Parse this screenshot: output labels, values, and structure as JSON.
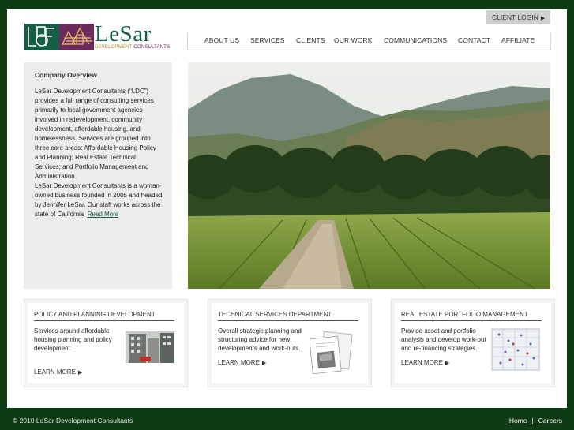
{
  "brand": {
    "name": "LeSar",
    "sub_line_1": "DEVELOPMENT",
    "sub_line_2": "CONSULTANTS"
  },
  "client_login": {
    "label": "CLIENT LOGIN",
    "icon": "triangle-right-icon"
  },
  "nav": {
    "items": [
      "ABOUT US",
      "SERVICES",
      "CLIENTS",
      "OUR WORK",
      "COMMUNICATIONS",
      "CONTACT",
      "AFFILIATE"
    ]
  },
  "sidebar": {
    "title": "Company Overview",
    "paragraph_1": "LeSar Development Consultants (“LDC”) provides a full range of consulting services primarily to local government agencies involved in redevelopment, community development, affordable housing, and homelessness. Services are grouped into three core areas: Affordable Housing Policy and Planning; Real Estate Technical Services; and Portfolio Management and Administration.",
    "paragraph_2": "LeSar Development Consultants is a woman-owned business founded in 2005 and headed by Jennifer LeSar. Our staff works across the state of California",
    "read_more": "Read More"
  },
  "cards": [
    {
      "title": "POLICY AND PLANNING DEVELOPMENT",
      "text": "Services around affordable housing planning and policy development.",
      "more": "LEARN MORE"
    },
    {
      "title": "TECHNICAL SERVICES DEPARTMENT",
      "text": "Overall strategic planning and structuring advice for new developments and work-outs.",
      "more": "LEARN MORE"
    },
    {
      "title": "REAL ESTATE PORTFOLIO MANAGEMENT",
      "text": "Provide asset and portfolio analysis and develop work-out and re-financing strategies.",
      "more": "LEARN MORE"
    }
  ],
  "footer": {
    "copyright": "© 2010 LeSar Development Consultants",
    "links": [
      "Home",
      "Careers"
    ],
    "separator": "|"
  },
  "colors": {
    "page_bg": "#0e3a14",
    "brand_green": "#155d45",
    "brand_gold": "#b8892a",
    "brand_purple": "#6a2a5a",
    "sidebar_bg": "#ececec"
  }
}
